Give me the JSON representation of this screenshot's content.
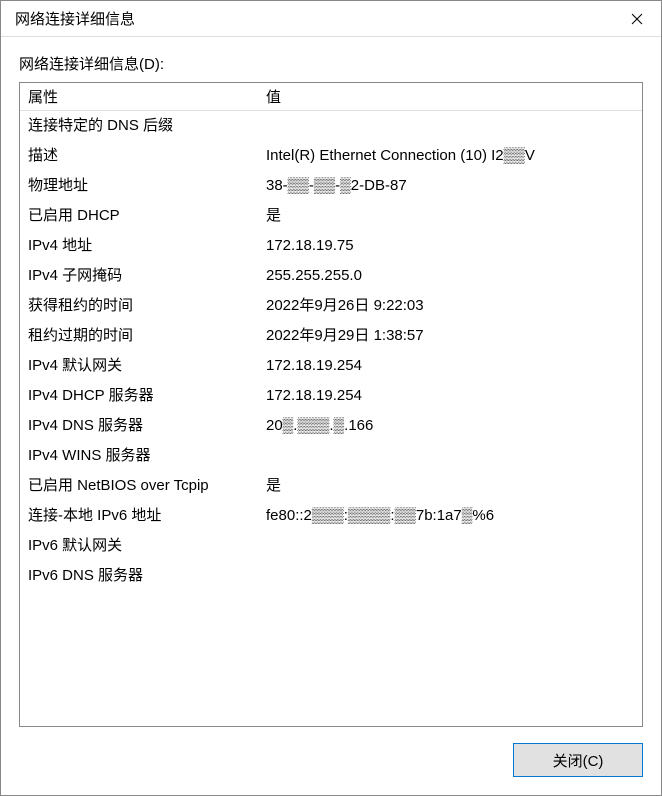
{
  "window": {
    "title": "网络连接详细信息"
  },
  "section_label": "网络连接详细信息(D):",
  "headers": {
    "property": "属性",
    "value": "值"
  },
  "rows": [
    {
      "prop": "连接特定的 DNS 后缀",
      "val": ""
    },
    {
      "prop": "描述",
      "val": "Intel(R) Ethernet Connection (10) I2▒▒V"
    },
    {
      "prop": "物理地址",
      "val": "38-▒▒-▒▒-▒2-DB-87"
    },
    {
      "prop": "已启用 DHCP",
      "val": "是"
    },
    {
      "prop": "IPv4 地址",
      "val": "172.18.19.75"
    },
    {
      "prop": "IPv4 子网掩码",
      "val": "255.255.255.0"
    },
    {
      "prop": "获得租约的时间",
      "val": "2022年9月26日 9:22:03"
    },
    {
      "prop": "租约过期的时间",
      "val": "2022年9月29日 1:38:57"
    },
    {
      "prop": "IPv4 默认网关",
      "val": "172.18.19.254"
    },
    {
      "prop": "IPv4 DHCP 服务器",
      "val": "172.18.19.254"
    },
    {
      "prop": "IPv4 DNS 服务器",
      "val": "20▒.▒▒▒.▒.166"
    },
    {
      "prop": "IPv4 WINS 服务器",
      "val": ""
    },
    {
      "prop": "已启用 NetBIOS over Tcpip",
      "val": "是"
    },
    {
      "prop": "连接-本地 IPv6 地址",
      "val": "fe80::2▒▒▒:▒▒▒▒:▒▒7b:1a7▒%6"
    },
    {
      "prop": "IPv6 默认网关",
      "val": ""
    },
    {
      "prop": "IPv6 DNS 服务器",
      "val": ""
    }
  ],
  "close_button": "关闭(C)"
}
